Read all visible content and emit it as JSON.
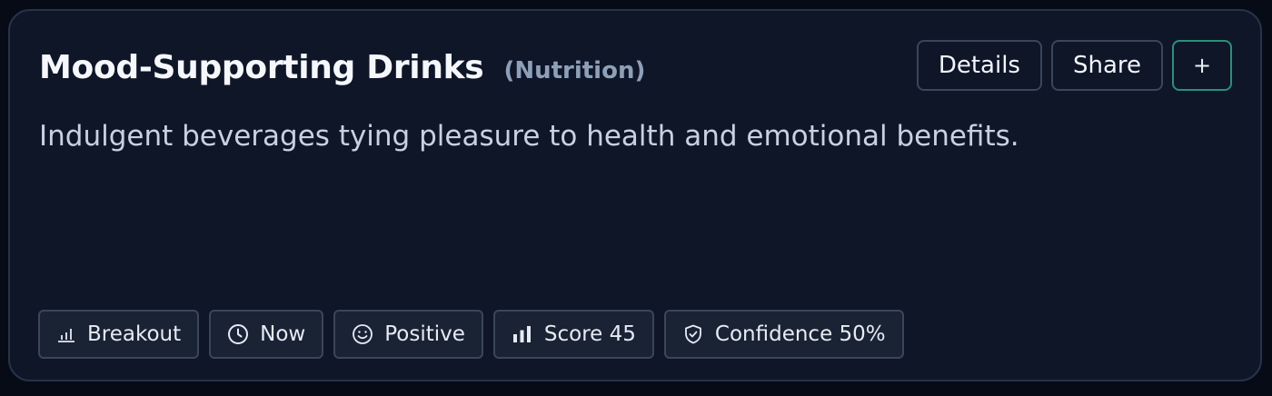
{
  "card": {
    "title": "Mood-Supporting Drinks",
    "category": "(Nutrition)",
    "description": "Indulgent beverages tying pleasure to health and emotional benefits."
  },
  "actions": {
    "details_label": "Details",
    "share_label": "Share",
    "add_label": "+"
  },
  "chips": [
    {
      "icon": "bar-chart-icon",
      "label": "Breakout"
    },
    {
      "icon": "clock-icon",
      "label": "Now"
    },
    {
      "icon": "smile-icon",
      "label": "Positive"
    },
    {
      "icon": "signal-bars-icon",
      "label": "Score 45"
    },
    {
      "icon": "shield-check-icon",
      "label": "Confidence 50%"
    }
  ],
  "colors": {
    "background": "#070b16",
    "card": "#0e1628",
    "accent_border": "#2c8f78"
  }
}
